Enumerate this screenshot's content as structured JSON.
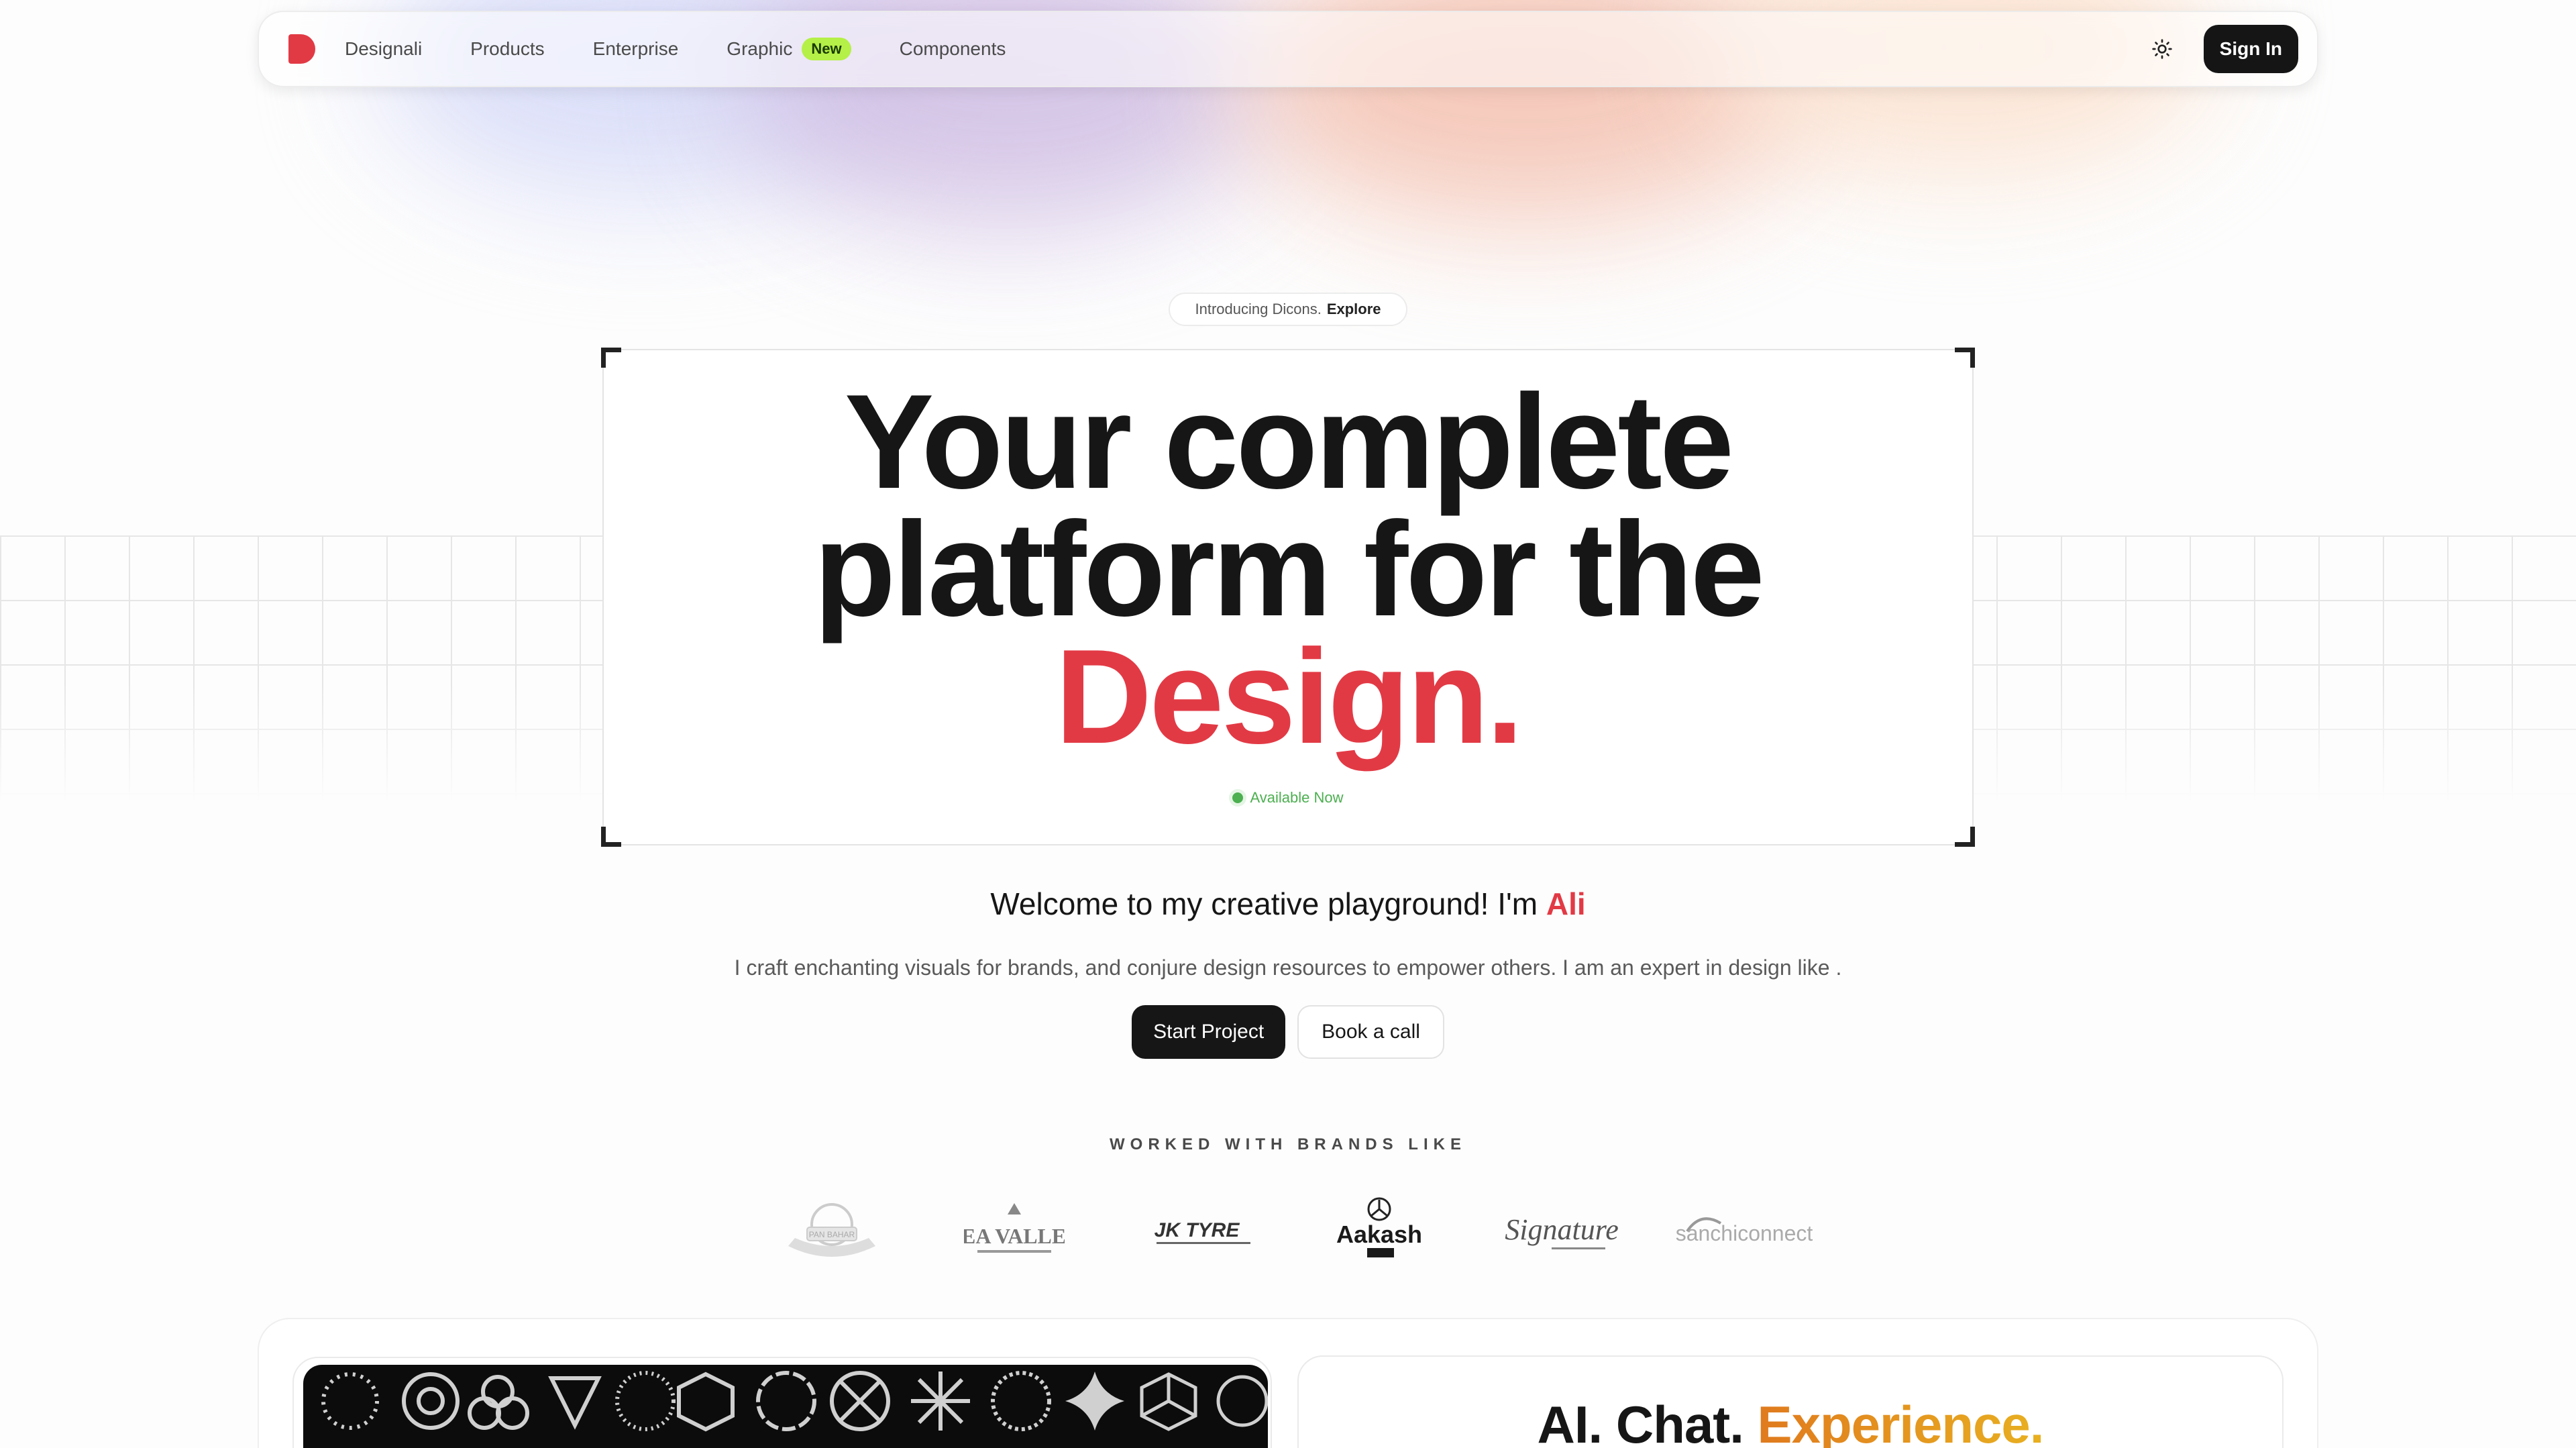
{
  "nav": {
    "items": [
      "Designali",
      "Products",
      "Enterprise",
      "Graphic",
      "Components"
    ],
    "new_badge": "New",
    "signin": "Sign In"
  },
  "intro": {
    "text": "Introducing Dicons.",
    "link": "Explore"
  },
  "hero": {
    "line1": "Your complete",
    "line2": "platform for the",
    "accent": "Design.",
    "status": "Available Now"
  },
  "welcome": {
    "text": "Welcome to my creative playground! I'm ",
    "name": "Ali"
  },
  "tagline": "I craft enchanting visuals for brands, and conjure design resources to empower others. I am an expert in design like .",
  "buttons": {
    "start": "Start Project",
    "book": "Book a call"
  },
  "brands": {
    "title": "WORKED WITH BRANDS LIKE",
    "logos": [
      "PAN BAHAR",
      "TEA VALLEY",
      "JK TYRE",
      "Aakash",
      "Signature",
      "sanchiconnect"
    ]
  },
  "cards": {
    "ai_prefix": "AI. Chat.",
    "ai_accent": "Experience."
  },
  "colors": {
    "accent": "#e23a45",
    "new_badge": "#b4f047",
    "status": "#4caf50"
  }
}
